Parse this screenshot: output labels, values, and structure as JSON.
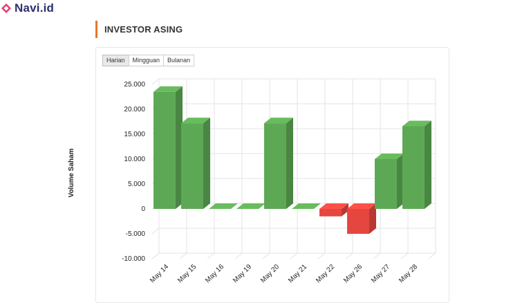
{
  "brand": {
    "name": "Navi.id",
    "icon": "navi-diamond-icon",
    "icon_color": "#e73a6d"
  },
  "section": {
    "title": "INVESTOR ASING",
    "accent_color": "#e8742c"
  },
  "tabs": [
    {
      "label": "Harian",
      "active": true
    },
    {
      "label": "Mingguan",
      "active": false
    },
    {
      "label": "Bulanan",
      "active": false
    }
  ],
  "chart_data": {
    "type": "bar",
    "three_d": true,
    "ylabel": "Volume Saham",
    "xlabel": "",
    "ylim": [
      -10000,
      25000
    ],
    "yticks": [
      25000,
      20000,
      15000,
      10000,
      5000,
      0,
      -5000,
      -10000
    ],
    "ytick_labels": [
      "25.000",
      "20.000",
      "15.000",
      "10.000",
      "5.000",
      "0",
      "-5.000",
      "-10.000"
    ],
    "categories": [
      "May 14",
      "May 15",
      "May 16",
      "May 19",
      "May 20",
      "May 21",
      "May 22",
      "May 26",
      "May 27",
      "May 28"
    ],
    "values": [
      23500,
      17200,
      0,
      0,
      17200,
      0,
      -1500,
      -5000,
      10000,
      16600
    ],
    "positive_color": "#5da854",
    "negative_color": "#e5473f",
    "grid": true
  }
}
